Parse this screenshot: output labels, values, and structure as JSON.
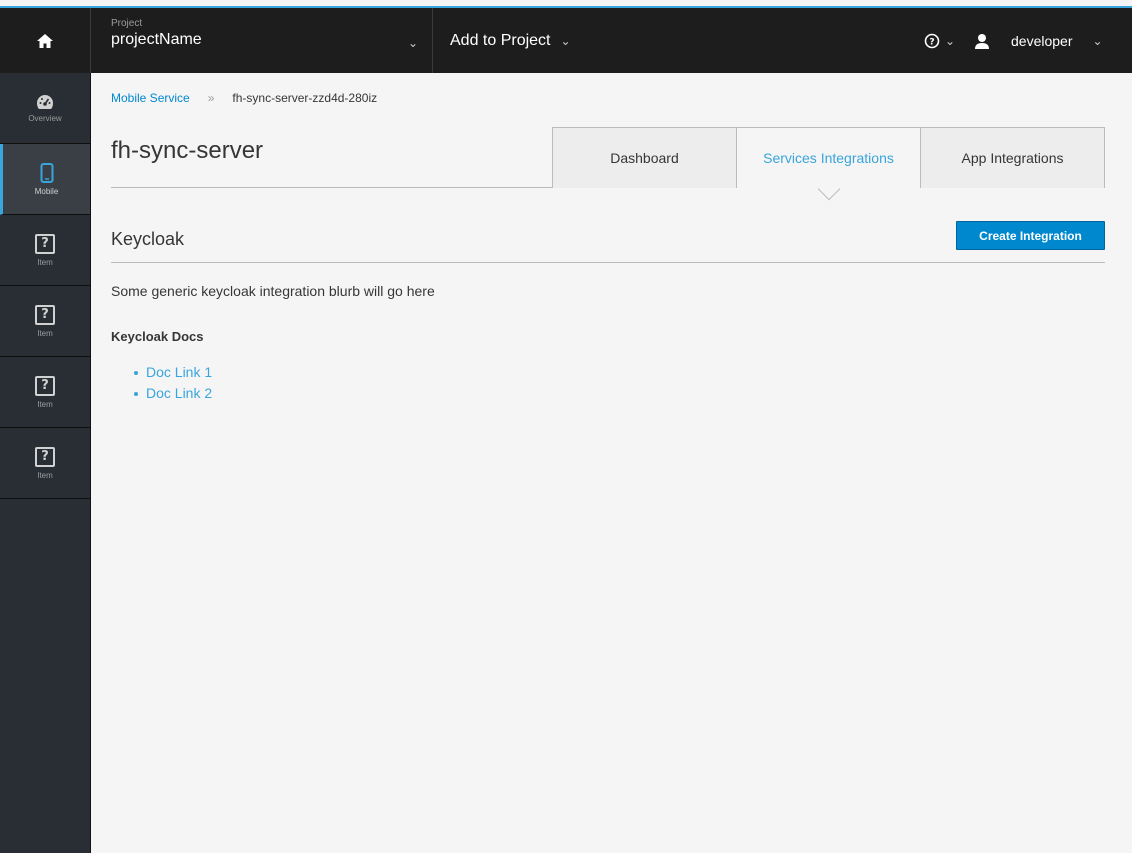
{
  "topbar": {
    "project_label": "Project",
    "project_name": "projectName",
    "add_to_project": "Add to Project",
    "username": "developer"
  },
  "sidebar": {
    "items": [
      {
        "label": "Overview",
        "icon": "dashboard-icon"
      },
      {
        "label": "Mobile",
        "icon": "mobile-icon"
      },
      {
        "label": "Item",
        "icon": "question-icon"
      },
      {
        "label": "Item",
        "icon": "question-icon"
      },
      {
        "label": "Item",
        "icon": "question-icon"
      },
      {
        "label": "Item",
        "icon": "question-icon"
      }
    ]
  },
  "breadcrumb": {
    "parent": "Mobile Service",
    "separator": "»",
    "current": "fh-sync-server-zzd4d-280iz"
  },
  "page": {
    "title": "fh-sync-server",
    "tabs": [
      "Dashboard",
      "Services Integrations",
      "App Integrations"
    ]
  },
  "section": {
    "title": "Keycloak",
    "create_label": "Create Integration",
    "blurb": "Some generic keycloak integration blurb will go here",
    "docs_title": "Keycloak Docs",
    "doc_links": [
      "Doc Link 1",
      "Doc Link 2"
    ]
  },
  "colors": {
    "accent": "#39a5dc",
    "primary_button": "#0088ce",
    "topbar_bg": "#1d1d1d",
    "sidebar_bg": "#292e34"
  }
}
